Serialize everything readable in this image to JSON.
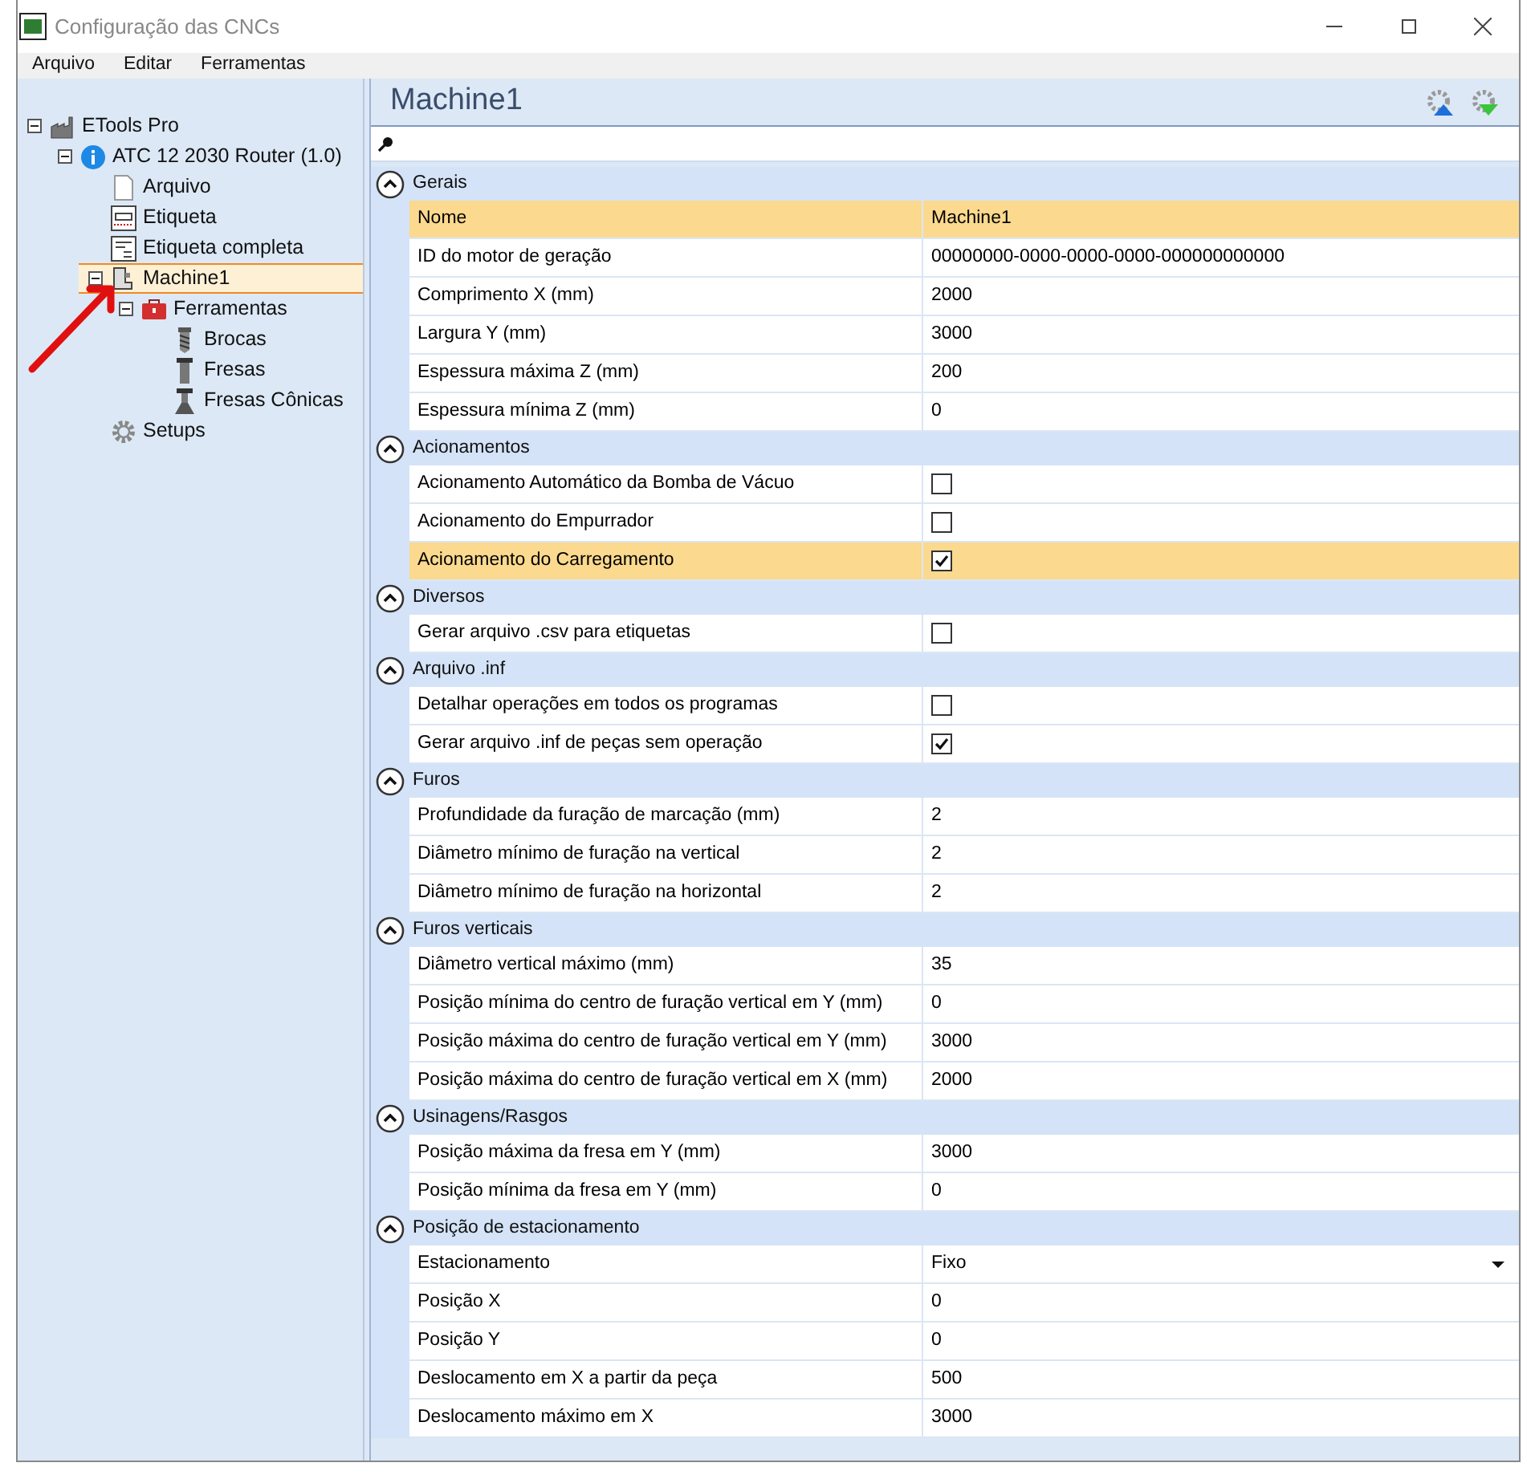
{
  "window": {
    "title": "Configuração das CNCs"
  },
  "menu": [
    "Arquivo",
    "Editar",
    "Ferramentas"
  ],
  "tree": [
    {
      "label": "ETools Pro",
      "kind": "factory",
      "expanded": true,
      "selected": false,
      "children": [
        {
          "label": "ATC 12 2030 Router (1.0)",
          "kind": "info",
          "expanded": true,
          "selected": false,
          "children": [
            {
              "label": "Arquivo",
              "kind": "file",
              "selected": false
            },
            {
              "label": "Etiqueta",
              "kind": "label",
              "selected": false
            },
            {
              "label": "Etiqueta completa",
              "kind": "label-full",
              "selected": false
            },
            {
              "label": "Machine1",
              "kind": "machine",
              "expanded": true,
              "selected": true,
              "children": [
                {
                  "label": "Ferramentas",
                  "kind": "toolbox",
                  "expanded": true,
                  "selected": false,
                  "children": [
                    {
                      "label": "Brocas",
                      "kind": "drill",
                      "selected": false
                    },
                    {
                      "label": "Fresas",
                      "kind": "mill",
                      "selected": false
                    },
                    {
                      "label": "Fresas Cônicas",
                      "kind": "cone",
                      "selected": false
                    }
                  ]
                }
              ]
            },
            {
              "label": "Setups",
              "kind": "gear",
              "selected": false
            }
          ]
        }
      ]
    }
  ],
  "panel": {
    "title": "Machine1"
  },
  "sections": [
    {
      "title": "Gerais",
      "expanded": true,
      "rows": [
        {
          "kind": "text",
          "label": "Nome",
          "value": "Machine1",
          "selected": true
        },
        {
          "kind": "text",
          "label": "ID do motor de geração",
          "value": "00000000-0000-0000-0000-000000000000",
          "selected": false
        },
        {
          "kind": "text",
          "label": "Comprimento X (mm)",
          "value": "2000",
          "selected": false
        },
        {
          "kind": "text",
          "label": "Largura Y (mm)",
          "value": "3000",
          "selected": false
        },
        {
          "kind": "text",
          "label": "Espessura máxima Z (mm)",
          "value": "200",
          "selected": false
        },
        {
          "kind": "text",
          "label": "Espessura mínima Z (mm)",
          "value": "0",
          "selected": false
        }
      ]
    },
    {
      "title": "Acionamentos",
      "expanded": true,
      "rows": [
        {
          "kind": "checkbox",
          "label": "Acionamento Automático da Bomba de Vácuo",
          "checked": false,
          "selected": false
        },
        {
          "kind": "checkbox",
          "label": "Acionamento do Empurrador",
          "checked": false,
          "selected": false
        },
        {
          "kind": "checkbox",
          "label": "Acionamento do Carregamento",
          "checked": true,
          "selected": true
        }
      ]
    },
    {
      "title": "Diversos",
      "expanded": true,
      "rows": [
        {
          "kind": "checkbox",
          "label": "Gerar arquivo .csv para etiquetas",
          "checked": false,
          "selected": false
        }
      ]
    },
    {
      "title": "Arquivo .inf",
      "expanded": true,
      "rows": [
        {
          "kind": "checkbox",
          "label": "Detalhar operações em todos os programas",
          "checked": false,
          "selected": false
        },
        {
          "kind": "checkbox",
          "label": "Gerar arquivo .inf de peças sem operação",
          "checked": true,
          "selected": false
        }
      ]
    },
    {
      "title": "Furos",
      "expanded": true,
      "rows": [
        {
          "kind": "text",
          "label": "Profundidade da furação de marcação (mm)",
          "value": "2",
          "selected": false
        },
        {
          "kind": "text",
          "label": "Diâmetro mínimo de furação na vertical",
          "value": "2",
          "selected": false
        },
        {
          "kind": "text",
          "label": "Diâmetro mínimo de furação na horizontal",
          "value": "2",
          "selected": false
        }
      ]
    },
    {
      "title": "Furos verticais",
      "expanded": true,
      "rows": [
        {
          "kind": "text",
          "label": "Diâmetro vertical máximo (mm)",
          "value": "35",
          "selected": false
        },
        {
          "kind": "text",
          "label": "Posição mínima do centro de furação vertical em Y (mm)",
          "value": "0",
          "selected": false
        },
        {
          "kind": "text",
          "label": "Posição máxima do centro de furação vertical em Y (mm)",
          "value": "3000",
          "selected": false
        },
        {
          "kind": "text",
          "label": "Posição máxima do centro de furação vertical em X (mm)",
          "value": "2000",
          "selected": false
        }
      ]
    },
    {
      "title": "Usinagens/Rasgos",
      "expanded": true,
      "rows": [
        {
          "kind": "text",
          "label": "Posição máxima da fresa em Y (mm)",
          "value": "3000",
          "selected": false
        },
        {
          "kind": "text",
          "label": "Posição mínima da fresa em Y (mm)",
          "value": "0",
          "selected": false
        }
      ]
    },
    {
      "title": "Posição de estacionamento",
      "expanded": true,
      "rows": [
        {
          "kind": "dropdown",
          "label": "Estacionamento",
          "value": "Fixo",
          "selected": false
        },
        {
          "kind": "text",
          "label": "Posição X",
          "value": "0",
          "selected": false
        },
        {
          "kind": "text",
          "label": "Posição Y",
          "value": "0",
          "selected": false
        },
        {
          "kind": "text",
          "label": "Deslocamento em X a partir da peça",
          "value": "500",
          "selected": false
        },
        {
          "kind": "text",
          "label": "Deslocamento máximo em X",
          "value": "3000",
          "selected": false
        }
      ]
    }
  ]
}
